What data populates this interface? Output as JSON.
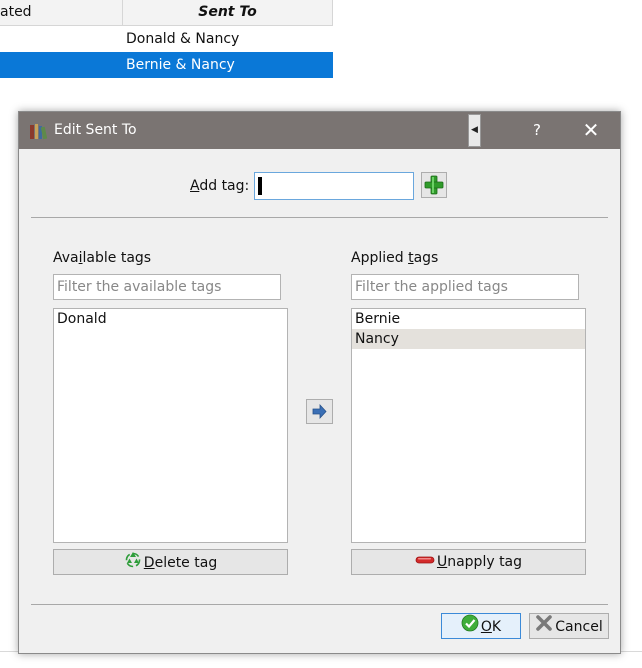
{
  "table": {
    "columns": [
      "ated",
      "Sent To"
    ],
    "rows": [
      {
        "sent_to": "Donald & Nancy",
        "selected": false
      },
      {
        "sent_to": "Bernie & Nancy",
        "selected": true
      }
    ],
    "selection_color": "#0a78d7"
  },
  "dialog": {
    "title": "Edit Sent To",
    "app_icon": "books-icon",
    "help": "?",
    "close": "✕",
    "titlebar_color": "#7a7472",
    "add_tag": {
      "label_first": "A",
      "label_rest": "dd tag:",
      "value": "",
      "button_icon": "green-plus-icon"
    },
    "available": {
      "title_pre": "Ava",
      "title_u": "i",
      "title_post": "lable tags",
      "filter_placeholder": "Filter the available tags",
      "items": [
        "Donald"
      ],
      "delete_first": "D",
      "delete_rest": "elete tag",
      "delete_icon": "recycle-icon"
    },
    "applied": {
      "title_pre": "Applied ",
      "title_u": "t",
      "title_post": "ags",
      "filter_placeholder": "Filter the applied tags",
      "items": [
        "Bernie",
        "Nancy"
      ],
      "highlighted_index": 1,
      "unapply_first": "U",
      "unapply_rest": "napply tag",
      "unapply_icon": "red-minus-icon"
    },
    "move_icon": "right-arrow-icon",
    "ok_first": "O",
    "ok_rest": "K",
    "cancel_label": "Cancel"
  }
}
